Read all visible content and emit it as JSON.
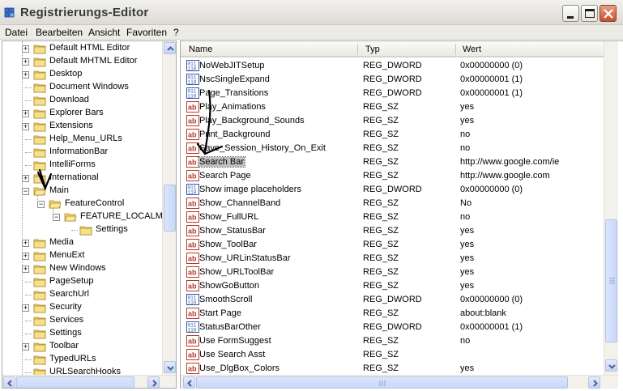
{
  "window": {
    "title": "Registrierungs-Editor"
  },
  "menu": [
    {
      "label": "Datei"
    },
    {
      "label": "Bearbeiten"
    },
    {
      "label": "Ansicht"
    },
    {
      "label": "Favoriten"
    },
    {
      "label": "?"
    }
  ],
  "tree": [
    {
      "label": "Default HTML Editor",
      "expander": "+"
    },
    {
      "label": "Default MHTML Editor",
      "expander": "+"
    },
    {
      "label": "Desktop",
      "expander": "+"
    },
    {
      "label": "Document Windows",
      "expander": ""
    },
    {
      "label": "Download",
      "expander": ""
    },
    {
      "label": "Explorer Bars",
      "expander": "+"
    },
    {
      "label": "Extensions",
      "expander": "+"
    },
    {
      "label": "Help_Menu_URLs",
      "expander": ""
    },
    {
      "label": "InformationBar",
      "expander": ""
    },
    {
      "label": "IntelliForms",
      "expander": ""
    },
    {
      "label": "International",
      "expander": "+"
    },
    {
      "label": "Main",
      "expander": "-"
    },
    {
      "label": "FeatureControl",
      "expander": "-"
    },
    {
      "label": "FEATURE_LOCALMA",
      "expander": "-"
    },
    {
      "label": "Settings",
      "expander": ""
    },
    {
      "label": "Media",
      "expander": "+"
    },
    {
      "label": "MenuExt",
      "expander": "+"
    },
    {
      "label": "New Windows",
      "expander": "+"
    },
    {
      "label": "PageSetup",
      "expander": ""
    },
    {
      "label": "SearchUrl",
      "expander": ""
    },
    {
      "label": "Security",
      "expander": "+"
    },
    {
      "label": "Services",
      "expander": ""
    },
    {
      "label": "Settings",
      "expander": ""
    },
    {
      "label": "Toolbar",
      "expander": "+"
    },
    {
      "label": "TypedURLs",
      "expander": ""
    },
    {
      "label": "URLSearchHooks",
      "expander": ""
    }
  ],
  "columns": {
    "name": "Name",
    "type": "Typ",
    "value": "Wert"
  },
  "rows": [
    {
      "name": "NoWebJITSetup",
      "type": "REG_DWORD",
      "value": "0x00000000 (0)",
      "icon": "dword-value-icon"
    },
    {
      "name": "NscSingleExpand",
      "type": "REG_DWORD",
      "value": "0x00000001 (1)",
      "icon": "dword-value-icon"
    },
    {
      "name": "Page_Transitions",
      "type": "REG_DWORD",
      "value": "0x00000001 (1)",
      "icon": "dword-value-icon"
    },
    {
      "name": "Play_Animations",
      "type": "REG_SZ",
      "value": "yes",
      "icon": "string-value-icon"
    },
    {
      "name": "Play_Background_Sounds",
      "type": "REG_SZ",
      "value": "yes",
      "icon": "string-value-icon"
    },
    {
      "name": "Print_Background",
      "type": "REG_SZ",
      "value": "no",
      "icon": "string-value-icon"
    },
    {
      "name": "Save_Session_History_On_Exit",
      "type": "REG_SZ",
      "value": "no",
      "icon": "string-value-icon"
    },
    {
      "name": "Search Bar",
      "type": "REG_SZ",
      "value": "http://www.google.com/ie",
      "icon": "string-value-icon",
      "selected": true
    },
    {
      "name": "Search Page",
      "type": "REG_SZ",
      "value": "http://www.google.com",
      "icon": "string-value-icon"
    },
    {
      "name": "Show image placeholders",
      "type": "REG_DWORD",
      "value": "0x00000000 (0)",
      "icon": "dword-value-icon"
    },
    {
      "name": "Show_ChannelBand",
      "type": "REG_SZ",
      "value": "No",
      "icon": "string-value-icon"
    },
    {
      "name": "Show_FullURL",
      "type": "REG_SZ",
      "value": "no",
      "icon": "string-value-icon"
    },
    {
      "name": "Show_StatusBar",
      "type": "REG_SZ",
      "value": "yes",
      "icon": "string-value-icon"
    },
    {
      "name": "Show_ToolBar",
      "type": "REG_SZ",
      "value": "yes",
      "icon": "string-value-icon"
    },
    {
      "name": "Show_URLinStatusBar",
      "type": "REG_SZ",
      "value": "yes",
      "icon": "string-value-icon"
    },
    {
      "name": "Show_URLToolBar",
      "type": "REG_SZ",
      "value": "yes",
      "icon": "string-value-icon"
    },
    {
      "name": "ShowGoButton",
      "type": "REG_SZ",
      "value": "yes",
      "icon": "string-value-icon"
    },
    {
      "name": "SmoothScroll",
      "type": "REG_DWORD",
      "value": "0x00000000 (0)",
      "icon": "dword-value-icon"
    },
    {
      "name": "Start Page",
      "type": "REG_SZ",
      "value": "about:blank",
      "icon": "string-value-icon"
    },
    {
      "name": "StatusBarOther",
      "type": "REG_DWORD",
      "value": "0x00000001 (1)",
      "icon": "dword-value-icon"
    },
    {
      "name": "Use FormSuggest",
      "type": "REG_SZ",
      "value": "no",
      "icon": "string-value-icon"
    },
    {
      "name": "Use Search Asst",
      "type": "REG_SZ",
      "value": "",
      "icon": "string-value-icon"
    },
    {
      "name": "Use_DlgBox_Colors",
      "type": "REG_SZ",
      "value": "yes",
      "icon": "string-value-icon"
    }
  ],
  "colors": {
    "selection": "#c0c0c0",
    "folder": "#f5d86a",
    "close_button": "#c94f2a",
    "scroll_accent": "#c4d3f6"
  }
}
